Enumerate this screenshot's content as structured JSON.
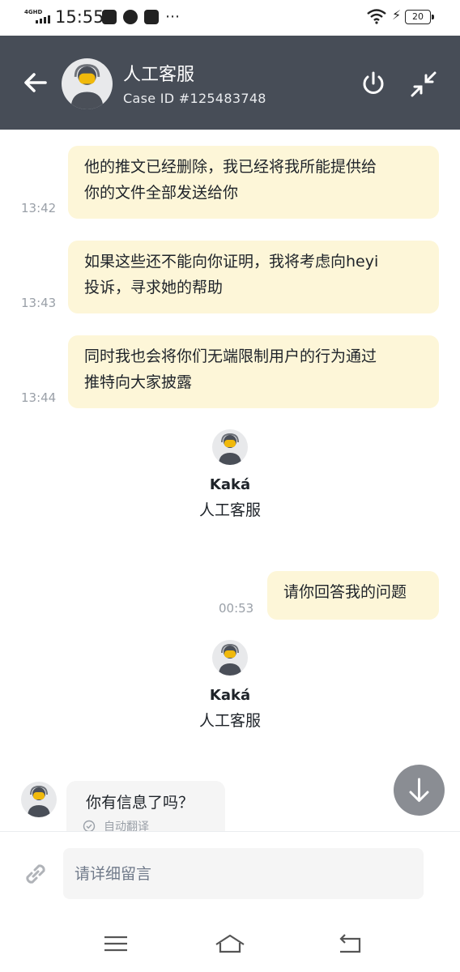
{
  "status_bar": {
    "network": "4GHD",
    "time": "15:55",
    "battery": "20"
  },
  "header": {
    "agent_name": "人工客服",
    "case_id": "Case ID #125483748"
  },
  "messages": [
    {
      "time": "13:42",
      "line1": "他的推文已经删除，我已经将我所能提供给",
      "line2": "你的文件全部发送给你"
    },
    {
      "time": "13:43",
      "line1": "如果这些还不能向你证明，我将考虑向heyi",
      "line2": "投诉，寻求她的帮助"
    },
    {
      "time": "13:44",
      "line1": "同时我也会将你们无端限制用户的行为通过",
      "line2": "推特向大家披露"
    }
  ],
  "agent_card_1": {
    "name": "Kaká",
    "role": "人工客服"
  },
  "outgoing_msg": {
    "time": "00:53",
    "text": "请你回答我的问题"
  },
  "agent_card_2": {
    "name": "Kaká",
    "role": "人工客服"
  },
  "incoming_msg": {
    "text": "你有信息了吗？",
    "translate_label": "自动翻译"
  },
  "input": {
    "placeholder": "请详细留言"
  },
  "colors": {
    "header_bg": "#474d57",
    "bubble_outgoing": "#fdf6d8",
    "bubble_incoming": "#f5f5f5",
    "avatar_accent": "#f0b90b"
  },
  "icons": [
    "back-arrow-icon",
    "agent-avatar-icon",
    "power-icon",
    "minimize-icon",
    "arrow-down-icon",
    "link-icon",
    "check-circle-icon",
    "menu-icon",
    "home-icon",
    "back-icon"
  ]
}
